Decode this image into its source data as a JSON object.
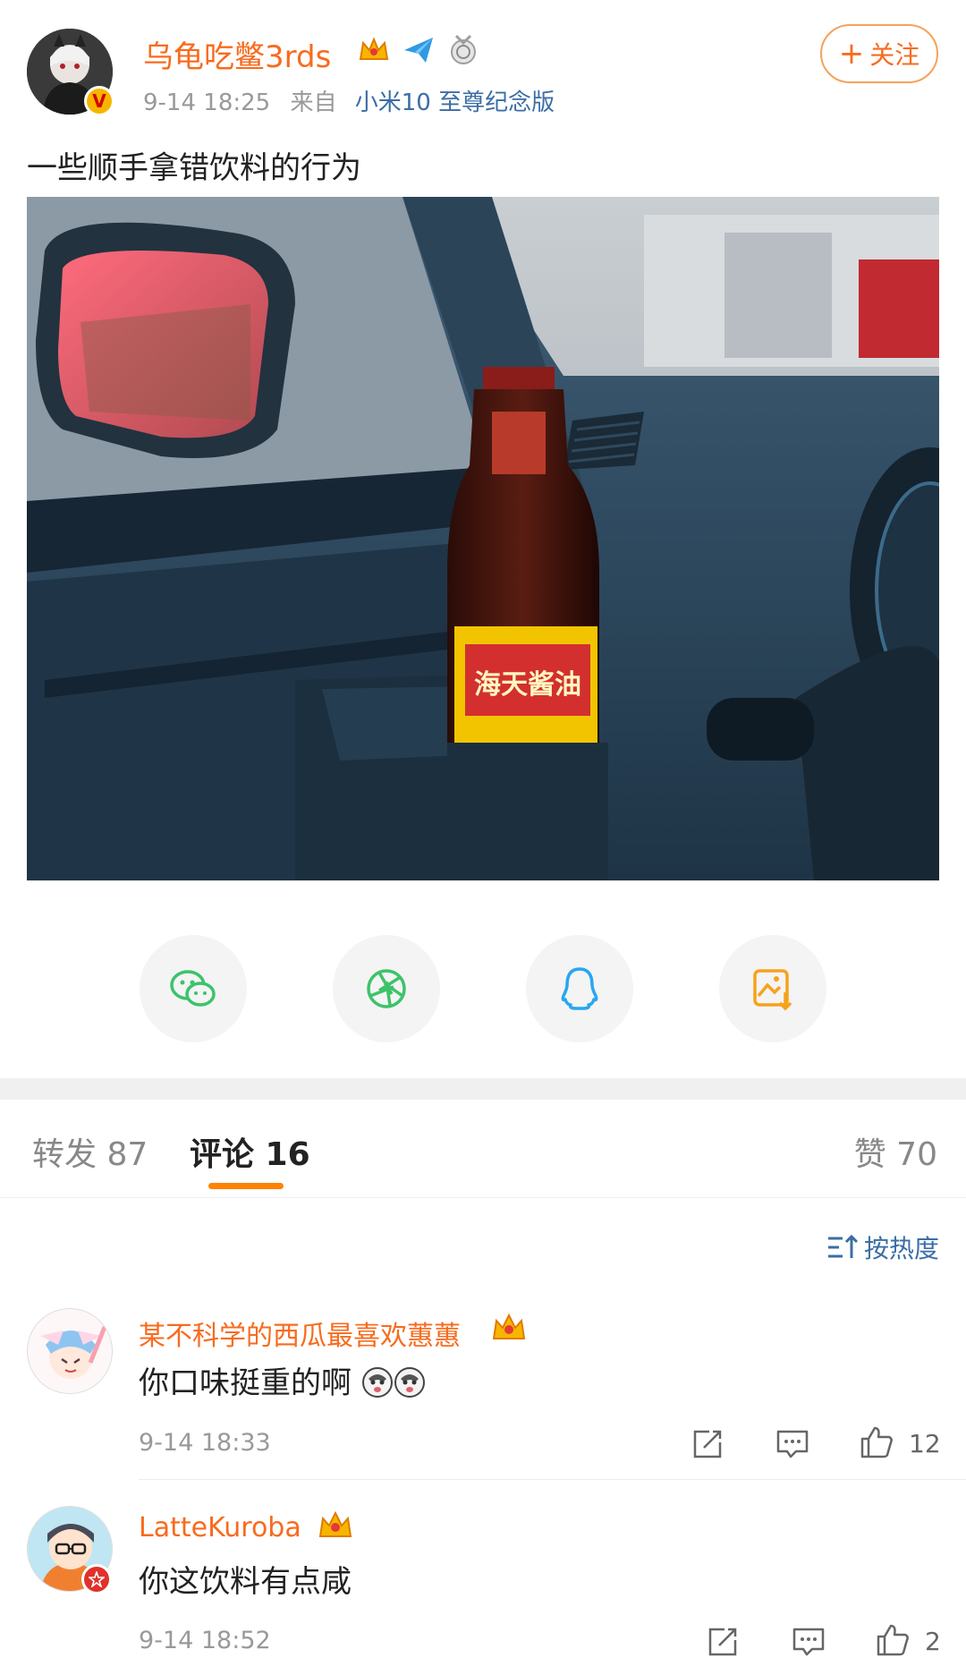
{
  "post": {
    "author": "乌龟吃鳖3rds",
    "time": "9-14 18:25",
    "source_prefix": "来自",
    "device": "小米10 至尊纪念版",
    "follow_label": "关注",
    "text": "一些顺手拿错饮料的行为",
    "photo_text": "海天酱油"
  },
  "tabs": {
    "repost": "转发 87",
    "comments": "评论 16",
    "likes": "赞 70"
  },
  "sort_label": "按热度",
  "comments": [
    {
      "name": "某不科学的西瓜最喜欢蕙蕙",
      "text": "你口味挺重的啊",
      "time": "9-14 18:33",
      "likes": "12"
    },
    {
      "name": "LatteKuroba",
      "text": "你这饮料有点咸",
      "time": "9-14 18:52",
      "likes": "2"
    }
  ],
  "colors": {
    "accent": "#ff8200",
    "name": "#f86b1d",
    "link": "#3b6ea5"
  },
  "icons": {
    "share_wechat": "wechat-icon",
    "share_moments": "moments-icon",
    "share_qq": "qq-icon",
    "share_save": "save-image-icon"
  }
}
